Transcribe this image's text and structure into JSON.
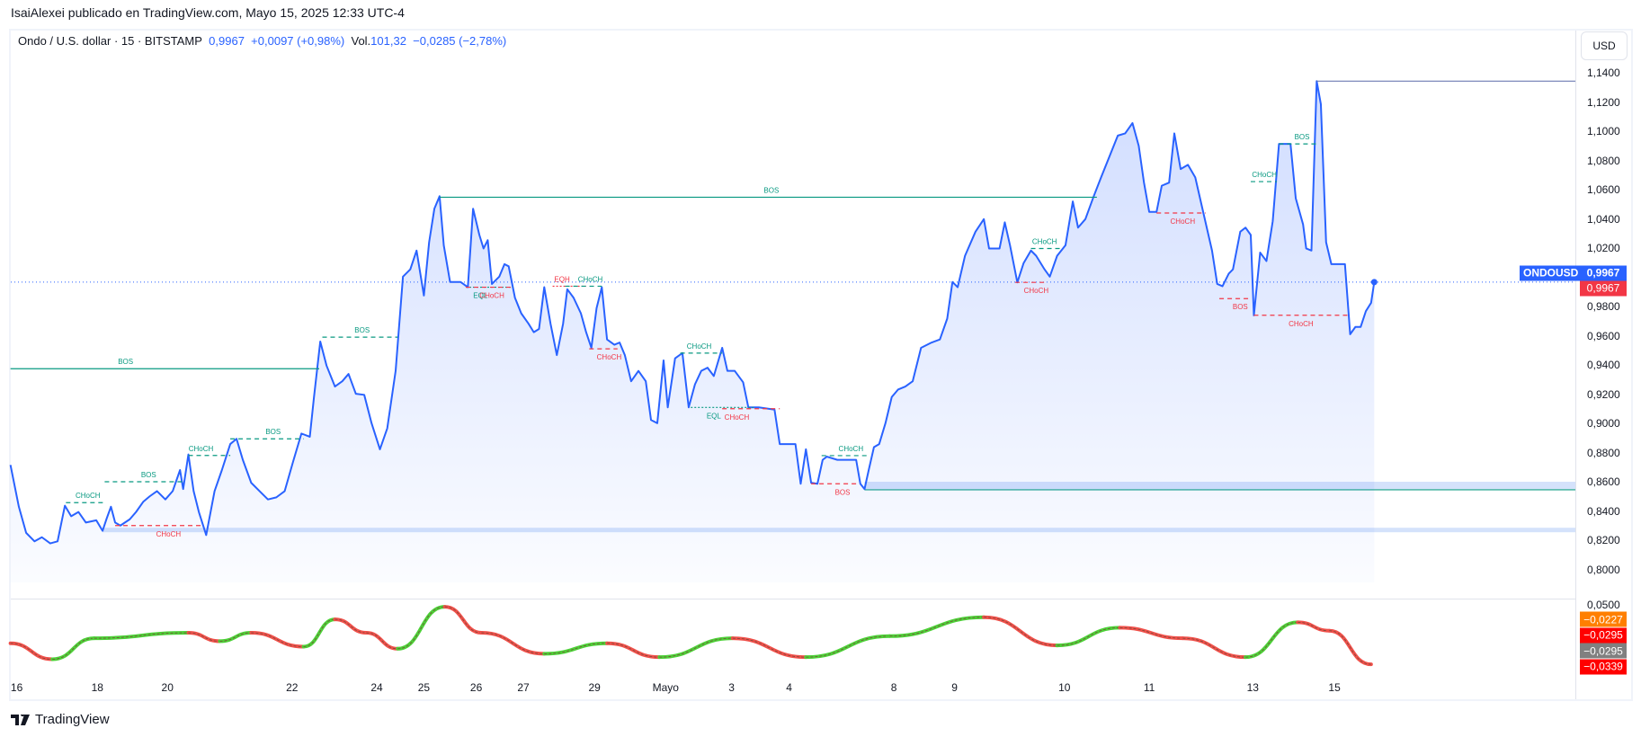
{
  "header": {
    "published": "IsaiAlexei publicado en TradingView.com, Mayo 15, 2025 12:33 UTC-4"
  },
  "legend": {
    "symbol": "Ondo / U.S. dollar · 15 · BITSTAMP",
    "price": "0,9967",
    "change": "+0,0097 (+0,98%)",
    "vol_label": "Vol.",
    "vol_value": "101,32",
    "vol_change": "−0,0285 (−2,78%)"
  },
  "currency_button": "USD",
  "price_axis": [
    "1,1400",
    "1,1200",
    "1,1000",
    "1,0800",
    "1,0600",
    "1,0400",
    "1,0200",
    "0,9800",
    "0,9600",
    "0,9400",
    "0,9200",
    "0,9000",
    "0,8800",
    "0,8600",
    "0,8400",
    "0,8200",
    "0,8000"
  ],
  "price_axis_values": [
    1.14,
    1.12,
    1.1,
    1.08,
    1.06,
    1.04,
    1.02,
    0.98,
    0.96,
    0.94,
    0.92,
    0.9,
    0.88,
    0.86,
    0.84,
    0.82,
    0.8
  ],
  "current_price": {
    "symbol": "ONDOUSD",
    "value": "0,9967",
    "close_tag": "0,9967",
    "price": 0.9967
  },
  "indicator": {
    "top_label": "0,0500",
    "tags": [
      {
        "value": "−0,0227",
        "color": "#ff7f00"
      },
      {
        "value": "−0,0295",
        "color": "#ff0000"
      },
      {
        "value": "−0,0295",
        "color": "#808080"
      },
      {
        "value": "−0,0339",
        "color": "#ff0000"
      }
    ],
    "series": [
      [
        10,
        -0.0284
      ],
      [
        50,
        -0.0322
      ],
      [
        90,
        -0.0272
      ],
      [
        180,
        -0.0259
      ],
      [
        210,
        -0.0279
      ],
      [
        240,
        -0.0259
      ],
      [
        290,
        -0.0292
      ],
      [
        320,
        -0.0227
      ],
      [
        350,
        -0.0259
      ],
      [
        380,
        -0.0297
      ],
      [
        425,
        -0.0197
      ],
      [
        460,
        -0.0259
      ],
      [
        520,
        -0.0309
      ],
      [
        580,
        -0.0284
      ],
      [
        630,
        -0.0317
      ],
      [
        700,
        -0.0272
      ],
      [
        770,
        -0.0317
      ],
      [
        850,
        -0.0267
      ],
      [
        940,
        -0.0222
      ],
      [
        1010,
        -0.0289
      ],
      [
        1070,
        -0.0247
      ],
      [
        1130,
        -0.0272
      ],
      [
        1190,
        -0.0317
      ],
      [
        1240,
        -0.0234
      ],
      [
        1270,
        -0.0254
      ],
      [
        1310,
        -0.0334
      ]
    ]
  },
  "time_axis": [
    {
      "label": "16",
      "bar": 16
    },
    {
      "label": "18",
      "bar": 93
    },
    {
      "label": "20",
      "bar": 160
    },
    {
      "label": "22",
      "bar": 279
    },
    {
      "label": "24",
      "bar": 360
    },
    {
      "label": "25",
      "bar": 405
    },
    {
      "label": "26",
      "bar": 455
    },
    {
      "label": "27",
      "bar": 500
    },
    {
      "label": "29",
      "bar": 568
    },
    {
      "label": "Mayo",
      "bar": 636
    },
    {
      "label": "3",
      "bar": 699
    },
    {
      "label": "4",
      "bar": 754
    },
    {
      "label": "8",
      "bar": 854
    },
    {
      "label": "9",
      "bar": 912
    },
    {
      "label": "10",
      "bar": 1017
    },
    {
      "label": "11",
      "bar": 1098
    },
    {
      "label": "13",
      "bar": 1197
    },
    {
      "label": "15",
      "bar": 1275
    }
  ],
  "colors": {
    "line": "#2962ff",
    "bull": "#089981",
    "bear": "#f23645",
    "band": "#cfdffb"
  },
  "chart_data": {
    "type": "area",
    "title": "Ondo / U.S. dollar · 15 · BITSTAMP",
    "ylabel": "USD",
    "ylim": [
      0.78,
      1.15
    ],
    "x_unit": "bar",
    "points": [
      [
        10,
        0.8715
      ],
      [
        18,
        0.8429
      ],
      [
        25,
        0.825
      ],
      [
        33,
        0.8192
      ],
      [
        40,
        0.822
      ],
      [
        48,
        0.8178
      ],
      [
        55,
        0.8192
      ],
      [
        62,
        0.8436
      ],
      [
        68,
        0.8364
      ],
      [
        75,
        0.8393
      ],
      [
        82,
        0.8321
      ],
      [
        92,
        0.8336
      ],
      [
        98,
        0.8264
      ],
      [
        102,
        0.835
      ],
      [
        106,
        0.8429
      ],
      [
        110,
        0.8321
      ],
      [
        115,
        0.83
      ],
      [
        124,
        0.8343
      ],
      [
        130,
        0.8393
      ],
      [
        137,
        0.8464
      ],
      [
        143,
        0.85
      ],
      [
        150,
        0.8536
      ],
      [
        158,
        0.8479
      ],
      [
        165,
        0.8536
      ],
      [
        172,
        0.868
      ],
      [
        175,
        0.855
      ],
      [
        180,
        0.8787
      ],
      [
        185,
        0.8536
      ],
      [
        190,
        0.8393
      ],
      [
        197,
        0.8235
      ],
      [
        205,
        0.8536
      ],
      [
        212,
        0.868
      ],
      [
        220,
        0.8858
      ],
      [
        226,
        0.8894
      ],
      [
        232,
        0.875
      ],
      [
        240,
        0.8593
      ],
      [
        248,
        0.8536
      ],
      [
        256,
        0.8479
      ],
      [
        264,
        0.8493
      ],
      [
        272,
        0.8536
      ],
      [
        280,
        0.8737
      ],
      [
        288,
        0.893
      ],
      [
        296,
        0.8908
      ],
      [
        300,
        0.918
      ],
      [
        306,
        0.956
      ],
      [
        312,
        0.9395
      ],
      [
        320,
        0.9252
      ],
      [
        327,
        0.9288
      ],
      [
        333,
        0.9338
      ],
      [
        340,
        0.9202
      ],
      [
        348,
        0.9195
      ],
      [
        355,
        0.9001
      ],
      [
        363,
        0.8822
      ],
      [
        370,
        0.8966
      ],
      [
        378,
        0.9359
      ],
      [
        385,
        1.0004
      ],
      [
        392,
        1.0054
      ],
      [
        398,
        1.0183
      ],
      [
        405,
        0.9875
      ],
      [
        410,
        1.024
      ],
      [
        415,
        1.0469
      ],
      [
        420,
        1.0555
      ],
      [
        424,
        1.0219
      ],
      [
        430,
        0.9968
      ],
      [
        440,
        0.9968
      ],
      [
        447,
        0.9932
      ],
      [
        452,
        1.0469
      ],
      [
        458,
        1.029
      ],
      [
        462,
        1.0197
      ],
      [
        466,
        1.0254
      ],
      [
        470,
        0.9954
      ],
      [
        477,
        1.0004
      ],
      [
        482,
        1.009
      ],
      [
        486,
        1.0075
      ],
      [
        492,
        0.986
      ],
      [
        498,
        0.9753
      ],
      [
        505,
        0.9682
      ],
      [
        510,
        0.9624
      ],
      [
        515,
        0.9646
      ],
      [
        520,
        0.9932
      ],
      [
        526,
        0.9682
      ],
      [
        532,
        0.9467
      ],
      [
        538,
        0.9682
      ],
      [
        542,
        0.9918
      ],
      [
        548,
        0.986
      ],
      [
        555,
        0.9753
      ],
      [
        560,
        0.9624
      ],
      [
        565,
        0.9517
      ],
      [
        570,
        0.9789
      ],
      [
        575,
        0.9932
      ],
      [
        580,
        0.9574
      ],
      [
        587,
        0.9538
      ],
      [
        592,
        0.9553
      ],
      [
        597,
        0.9467
      ],
      [
        603,
        0.9288
      ],
      [
        610,
        0.9359
      ],
      [
        617,
        0.9288
      ],
      [
        622,
        0.9023
      ],
      [
        628,
        0.9001
      ],
      [
        634,
        0.9431
      ],
      [
        638,
        0.9109
      ],
      [
        645,
        0.9445
      ],
      [
        652,
        0.9481
      ],
      [
        658,
        0.9109
      ],
      [
        664,
        0.9267
      ],
      [
        670,
        0.9359
      ],
      [
        676,
        0.9381
      ],
      [
        682,
        0.9324
      ],
      [
        690,
        0.9517
      ],
      [
        695,
        0.9359
      ],
      [
        702,
        0.9359
      ],
      [
        710,
        0.9281
      ],
      [
        715,
        0.9109
      ],
      [
        725,
        0.9109
      ],
      [
        740,
        0.9094
      ],
      [
        745,
        0.8858
      ],
      [
        760,
        0.8858
      ],
      [
        765,
        0.8586
      ],
      [
        770,
        0.8822
      ],
      [
        775,
        0.8593
      ],
      [
        781,
        0.8586
      ],
      [
        786,
        0.875
      ],
      [
        790,
        0.8772
      ],
      [
        800,
        0.875
      ],
      [
        810,
        0.875
      ],
      [
        818,
        0.875
      ],
      [
        822,
        0.8586
      ],
      [
        826,
        0.855
      ],
      [
        830,
        0.868
      ],
      [
        835,
        0.8837
      ],
      [
        840,
        0.8858
      ],
      [
        846,
        0.9001
      ],
      [
        852,
        0.918
      ],
      [
        858,
        0.9231
      ],
      [
        865,
        0.9252
      ],
      [
        872,
        0.9288
      ],
      [
        880,
        0.9517
      ],
      [
        890,
        0.9553
      ],
      [
        898,
        0.9574
      ],
      [
        905,
        0.9717
      ],
      [
        910,
        0.9968
      ],
      [
        915,
        0.9932
      ],
      [
        922,
        1.0147
      ],
      [
        932,
        1.0312
      ],
      [
        940,
        1.0398
      ],
      [
        945,
        1.0197
      ],
      [
        955,
        1.0197
      ],
      [
        960,
        1.0376
      ],
      [
        965,
        1.0219
      ],
      [
        972,
        0.9965
      ],
      [
        978,
        1.0097
      ],
      [
        985,
        1.0183
      ],
      [
        990,
        1.0147
      ],
      [
        998,
        1.0054
      ],
      [
        1003,
        1.0004
      ],
      [
        1010,
        1.0147
      ],
      [
        1018,
        1.0219
      ],
      [
        1025,
        1.0519
      ],
      [
        1030,
        1.034
      ],
      [
        1037,
        1.0398
      ],
      [
        1045,
        1.0555
      ],
      [
        1052,
        1.0684
      ],
      [
        1060,
        1.0827
      ],
      [
        1068,
        1.097
      ],
      [
        1075,
        1.0985
      ],
      [
        1082,
        1.1056
      ],
      [
        1088,
        1.0899
      ],
      [
        1093,
        1.0648
      ],
      [
        1098,
        1.0448
      ],
      [
        1105,
        1.0448
      ],
      [
        1110,
        1.0627
      ],
      [
        1117,
        1.0648
      ],
      [
        1122,
        1.0985
      ],
      [
        1128,
        1.0741
      ],
      [
        1135,
        1.077
      ],
      [
        1142,
        1.0684
      ],
      [
        1150,
        1.0433
      ],
      [
        1158,
        1.0183
      ],
      [
        1163,
        0.9954
      ],
      [
        1168,
        0.9939
      ],
      [
        1174,
        1.0025
      ],
      [
        1178,
        1.0054
      ],
      [
        1185,
        1.0312
      ],
      [
        1190,
        1.034
      ],
      [
        1195,
        1.029
      ],
      [
        1198,
        0.9739
      ],
      [
        1204,
        1.0169
      ],
      [
        1210,
        1.0111
      ],
      [
        1216,
        1.0383
      ],
      [
        1222,
        1.0913
      ],
      [
        1233,
        1.0913
      ],
      [
        1238,
        1.0541
      ],
      [
        1245,
        1.0362
      ],
      [
        1248,
        1.0197
      ],
      [
        1253,
        1.0183
      ],
      [
        1258,
        1.1343
      ],
      [
        1262,
        1.1185
      ],
      [
        1267,
        1.024
      ],
      [
        1272,
        1.009
      ],
      [
        1285,
        1.009
      ],
      [
        1290,
        0.961
      ],
      [
        1295,
        0.966
      ],
      [
        1300,
        0.966
      ],
      [
        1305,
        0.9768
      ],
      [
        1310,
        0.9825
      ],
      [
        1313,
        0.9967
      ]
    ],
    "levels": [
      {
        "label": "BOS",
        "price": 0.9374,
        "from": 10,
        "to": 305,
        "label_at": 120,
        "kind": "bull",
        "style": "solid",
        "pos": "above"
      },
      {
        "label": "BOS",
        "price": 1.0548,
        "from": 420,
        "to": 1048,
        "label_at": 737,
        "kind": "bull",
        "style": "solid",
        "pos": "above"
      },
      {
        "label": "CHoCH",
        "price": 0.8457,
        "from": 63,
        "to": 100,
        "label_at": 84,
        "kind": "bull",
        "style": "dash",
        "pos": "above"
      },
      {
        "label": "BOS",
        "price": 0.86,
        "from": 100,
        "to": 175,
        "label_at": 142,
        "kind": "bull",
        "style": "dash",
        "pos": "above"
      },
      {
        "label": "CHoCH",
        "price": 0.878,
        "from": 180,
        "to": 220,
        "label_at": 192,
        "kind": "bull",
        "style": "dash",
        "pos": "above"
      },
      {
        "label": "BOS",
        "price": 0.8894,
        "from": 220,
        "to": 290,
        "label_at": 261,
        "kind": "bull",
        "style": "dash",
        "pos": "above"
      },
      {
        "label": "BOS",
        "price": 0.959,
        "from": 308,
        "to": 380,
        "label_at": 346,
        "kind": "bull",
        "style": "dash",
        "pos": "above"
      },
      {
        "label": "CHoCH",
        "price": 0.83,
        "from": 110,
        "to": 195,
        "label_at": 161,
        "kind": "bear",
        "style": "dash",
        "pos": "below"
      },
      {
        "label": "EQL",
        "price": 0.9932,
        "from": 445,
        "to": 490,
        "label_at": 459,
        "kind": "bull",
        "style": "dot",
        "pos": "below"
      },
      {
        "label": "CHoCH",
        "price": 0.9932,
        "from": 445,
        "to": 490,
        "label_at": 470,
        "kind": "bear",
        "style": "dash",
        "pos": "below"
      },
      {
        "label": "EQH",
        "price": 0.9939,
        "from": 528,
        "to": 560,
        "label_at": 537,
        "kind": "bear",
        "style": "dot",
        "pos": "above"
      },
      {
        "label": "CHoCH",
        "price": 0.9939,
        "from": 540,
        "to": 575,
        "label_at": 564,
        "kind": "bull",
        "style": "dash",
        "pos": "above"
      },
      {
        "label": "CHoCH",
        "price": 0.951,
        "from": 563,
        "to": 590,
        "label_at": 582,
        "kind": "bear",
        "style": "dash",
        "pos": "below"
      },
      {
        "label": "CHoCH",
        "price": 0.9481,
        "from": 650,
        "to": 690,
        "label_at": 668,
        "kind": "bull",
        "style": "dash",
        "pos": "above"
      },
      {
        "label": "EQL",
        "price": 0.9109,
        "from": 660,
        "to": 720,
        "label_at": 682,
        "kind": "bull",
        "style": "dot",
        "pos": "below"
      },
      {
        "label": "CHoCH",
        "price": 0.91,
        "from": 690,
        "to": 745,
        "label_at": 704,
        "kind": "bear",
        "style": "dash",
        "pos": "below"
      },
      {
        "label": "BOS",
        "price": 0.8586,
        "from": 775,
        "to": 820,
        "label_at": 805,
        "kind": "bear",
        "style": "dash",
        "pos": "below"
      },
      {
        "label": "CHoCH",
        "price": 0.8779,
        "from": 785,
        "to": 830,
        "label_at": 813,
        "kind": "bull",
        "style": "dash",
        "pos": "above"
      },
      {
        "label": "CHoCH",
        "price": 1.0197,
        "from": 985,
        "to": 1015,
        "label_at": 998,
        "kind": "bull",
        "style": "dash",
        "pos": "above"
      },
      {
        "label": "CHoCH",
        "price": 0.9965,
        "from": 970,
        "to": 1000,
        "label_at": 990,
        "kind": "bear",
        "style": "dash",
        "pos": "below"
      },
      {
        "label": "CHoCH",
        "price": 1.044,
        "from": 1105,
        "to": 1152,
        "label_at": 1130,
        "kind": "bear",
        "style": "dash",
        "pos": "below"
      },
      {
        "label": "BOS",
        "price": 0.9854,
        "from": 1165,
        "to": 1195,
        "label_at": 1185,
        "kind": "bear",
        "style": "dash",
        "pos": "below"
      },
      {
        "label": "CHoCH",
        "price": 0.974,
        "from": 1198,
        "to": 1288,
        "label_at": 1243,
        "kind": "bear",
        "style": "dash",
        "pos": "below"
      },
      {
        "label": "CHoCH",
        "price": 1.0655,
        "from": 1195,
        "to": 1220,
        "label_at": 1208,
        "kind": "bull",
        "style": "dash",
        "pos": "above"
      },
      {
        "label": "BOS",
        "price": 1.0913,
        "from": 1222,
        "to": 1258,
        "label_at": 1244,
        "kind": "bull",
        "style": "dash",
        "pos": "above"
      }
    ],
    "high_line": {
      "price": 1.1343,
      "from": 1258
    },
    "zones": [
      {
        "top": 0.8285,
        "bottom": 0.8265,
        "from": 98
      },
      {
        "top": 0.86,
        "bottom": 0.855,
        "from": 826
      }
    ],
    "zone_line": {
      "price": 0.8545,
      "from": 826
    }
  }
}
